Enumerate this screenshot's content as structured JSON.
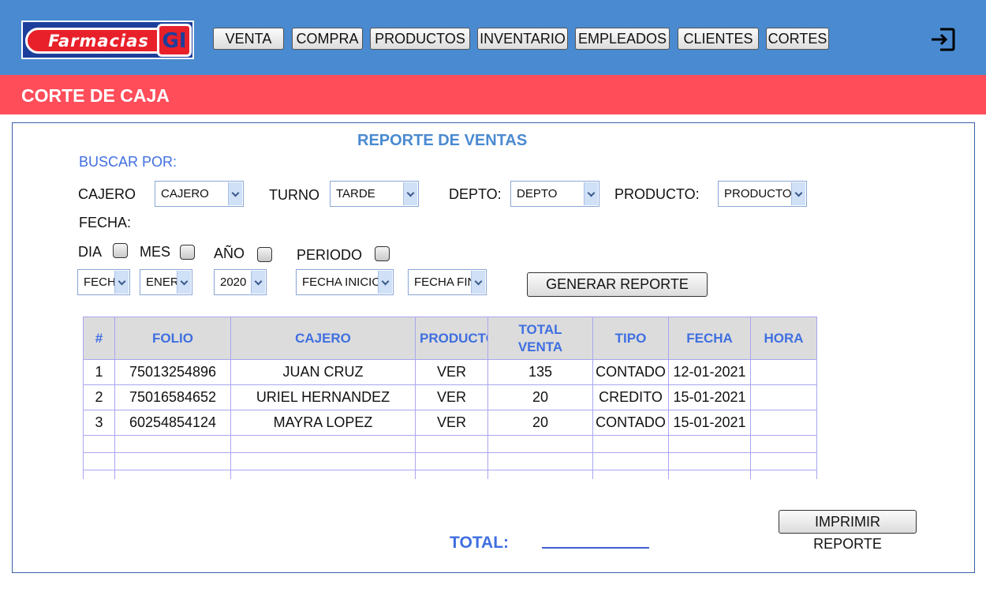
{
  "header": {
    "logo_text": "Farmacias",
    "logo_mark": "GI",
    "nav": [
      "VENTA",
      "COMPRA",
      "PRODUCTOS",
      "INVENTARIO",
      "EMPLEADOS",
      "CLIENTES",
      "CORTES"
    ],
    "logout_icon": "logout-icon"
  },
  "page": {
    "title": "CORTE DE CAJA"
  },
  "report": {
    "title": "REPORTE DE VENTAS",
    "search_by": "BUSCAR POR:",
    "filters": {
      "cajero_label": "CAJERO",
      "cajero_value": "CAJERO",
      "turno_label": "TURNO",
      "turno_value": "TARDE",
      "depto_label": "DEPTO:",
      "depto_value": "DEPTO",
      "producto_label": "PRODUCTO:",
      "producto_value": "PRODUCTO"
    },
    "fecha_label": "FECHA:",
    "date_options": {
      "dia": "DIA",
      "mes": "MES",
      "anio": "AÑO",
      "periodo": "PERIODO"
    },
    "date_selects": {
      "fecha": "FECHA",
      "mes": "ENERO",
      "anio": "2020",
      "fecha_inicio": "FECHA INICIO",
      "fecha_fin": "FECHA FIN"
    },
    "generate_button": "GENERAR REPORTE",
    "table": {
      "headers": [
        "#",
        "FOLIO",
        "CAJERO",
        "PRODUCTO",
        "TOTAL VENTA",
        "TIPO",
        "FECHA",
        "HORA"
      ],
      "rows": [
        [
          "1",
          "75013254896",
          "JUAN CRUZ",
          "VER",
          "135",
          "CONTADO",
          "12-01-2021",
          ""
        ],
        [
          "2",
          "75016584652",
          "URIEL HERNANDEZ",
          "VER",
          "20",
          "CREDITO",
          "15-01-2021",
          ""
        ],
        [
          "3",
          "60254854124",
          "MAYRA LOPEZ",
          "VER",
          "20",
          "CONTADO",
          "15-01-2021",
          ""
        ]
      ]
    },
    "print_button": "IMPRIMIR REPORTE",
    "total_label": "TOTAL:"
  }
}
